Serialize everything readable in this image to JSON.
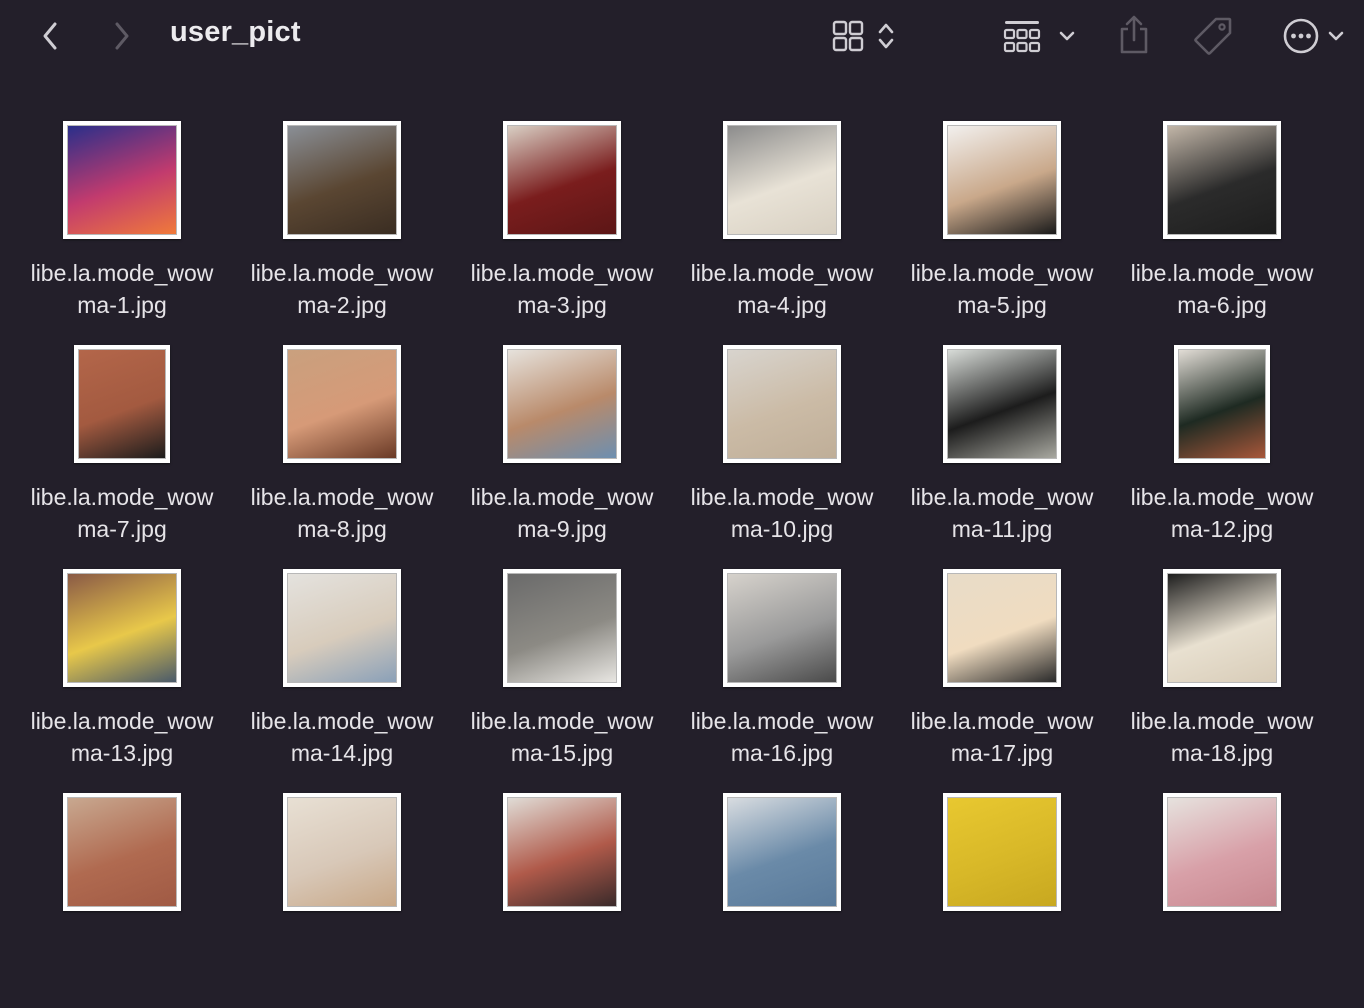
{
  "window": {
    "title": "user_pict"
  },
  "toolbar": {
    "back_icon": "chevron-left-icon",
    "forward_icon": "chevron-right-icon",
    "view_icon": "icon-grid-view-icon",
    "view_switch_icon": "chevron-up-down-icon",
    "group_icon": "group-by-icon",
    "group_menu_icon": "chevron-down-icon",
    "share_icon": "share-icon",
    "tag_icon": "tag-icon",
    "more_icon": "ellipsis-circle-icon",
    "more_menu_icon": "chevron-down-icon"
  },
  "files": [
    {
      "line1": "libe.la.mode_wow",
      "line2": "ma-1.jpg",
      "colors": [
        "#2a2f8a",
        "#c23b6e",
        "#f07a3a"
      ]
    },
    {
      "line1": "libe.la.mode_wow",
      "line2": "ma-2.jpg",
      "colors": [
        "#8a8f96",
        "#5a4632",
        "#3a2d22"
      ]
    },
    {
      "line1": "libe.la.mode_wow",
      "line2": "ma-3.jpg",
      "colors": [
        "#d9cfc4",
        "#7a1d1d",
        "#5c1616"
      ]
    },
    {
      "line1": "libe.la.mode_wow",
      "line2": "ma-4.jpg",
      "colors": [
        "#8c8c8c",
        "#e8e2d6",
        "#d8d0c2"
      ]
    },
    {
      "line1": "libe.la.mode_wow",
      "line2": "ma-5.jpg",
      "colors": [
        "#f2f0ee",
        "#c9a88a",
        "#1a1a1a"
      ]
    },
    {
      "line1": "libe.la.mode_wow",
      "line2": "ma-6.jpg",
      "colors": [
        "#c2b6a8",
        "#2b2b2b",
        "#1e1e1e"
      ]
    },
    {
      "line1": "libe.la.mode_wow",
      "line2": "ma-7.jpg",
      "colors": [
        "#b3664a",
        "#a35a40",
        "#1c1c1c"
      ]
    },
    {
      "line1": "libe.la.mode_wow",
      "line2": "ma-8.jpg",
      "colors": [
        "#c9a07e",
        "#d69a78",
        "#6a3a26"
      ]
    },
    {
      "line1": "libe.la.mode_wow",
      "line2": "ma-9.jpg",
      "colors": [
        "#e6e2dc",
        "#b98a6a",
        "#6d8fb0"
      ]
    },
    {
      "line1": "libe.la.mode_wow",
      "line2": "ma-10.jpg",
      "colors": [
        "#d8d4ce",
        "#cbbba6",
        "#bfae98"
      ]
    },
    {
      "line1": "libe.la.mode_wow",
      "line2": "ma-11.jpg",
      "colors": [
        "#d8dcd8",
        "#1c1c1c",
        "#a8a8a0"
      ]
    },
    {
      "line1": "libe.la.mode_wow",
      "line2": "ma-12.jpg",
      "colors": [
        "#e2ddd6",
        "#1e2a22",
        "#a8573a"
      ]
    },
    {
      "line1": "libe.la.mode_wow",
      "line2": "ma-13.jpg",
      "colors": [
        "#8a5a46",
        "#e8c84a",
        "#4a5a6a"
      ]
    },
    {
      "line1": "libe.la.mode_wow",
      "line2": "ma-14.jpg",
      "colors": [
        "#e4e2de",
        "#d8ccbc",
        "#8aa0b8"
      ]
    },
    {
      "line1": "libe.la.mode_wow",
      "line2": "ma-15.jpg",
      "colors": [
        "#6a6a6a",
        "#8c8a84",
        "#e8e6e2"
      ]
    },
    {
      "line1": "libe.la.mode_wow",
      "line2": "ma-16.jpg",
      "colors": [
        "#d6d2cc",
        "#9a9a9a",
        "#4a4a4a"
      ]
    },
    {
      "line1": "libe.la.mode_wow",
      "line2": "ma-17.jpg",
      "colors": [
        "#e8dcc8",
        "#f0dcc0",
        "#2a2a2a"
      ]
    },
    {
      "line1": "libe.la.mode_wow",
      "line2": "ma-18.jpg",
      "colors": [
        "#1e1e1e",
        "#e8e0d0",
        "#d8ccb8"
      ]
    },
    {
      "line1": "",
      "line2": "",
      "colors": [
        "#c8a890",
        "#b06a50",
        "#a05a44"
      ]
    },
    {
      "line1": "",
      "line2": "",
      "colors": [
        "#e8e0d4",
        "#d8c8b8",
        "#c8a888"
      ]
    },
    {
      "line1": "",
      "line2": "",
      "colors": [
        "#e0dcd6",
        "#b05a4a",
        "#3a2a2a"
      ]
    },
    {
      "line1": "",
      "line2": "",
      "colors": [
        "#d8dce0",
        "#6a8aa8",
        "#5a7a9a"
      ]
    },
    {
      "line1": "",
      "line2": "",
      "colors": [
        "#e8c830",
        "#d8b828",
        "#c8a820"
      ]
    },
    {
      "line1": "",
      "line2": "",
      "colors": [
        "#e6e2de",
        "#d8a0a8",
        "#c88890"
      ]
    }
  ]
}
